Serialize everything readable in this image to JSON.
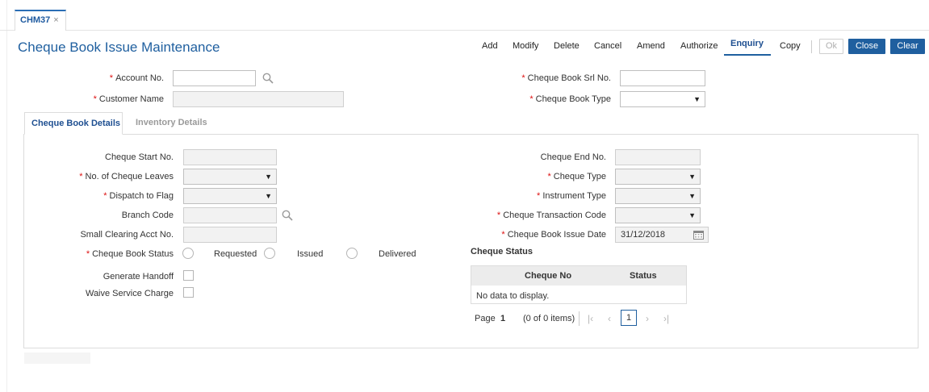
{
  "tab": {
    "label": "CHM37",
    "close": "×"
  },
  "title": "Cheque Book Issue Maintenance",
  "toolbar": {
    "links": [
      "Add",
      "Modify",
      "Delete",
      "Cancel",
      "Amend",
      "Authorize",
      "Enquiry",
      "Copy"
    ],
    "active": "Enquiry",
    "ok": "Ok",
    "close": "Close",
    "clear": "Clear"
  },
  "header_form": {
    "account_no": {
      "label": "Account No.",
      "value": ""
    },
    "customer_name": {
      "label": "Customer Name",
      "value": ""
    },
    "cheque_book_srl_no": {
      "label": "Cheque Book Srl No.",
      "value": ""
    },
    "cheque_book_type": {
      "label": "Cheque Book Type",
      "value": ""
    }
  },
  "subtabs": {
    "details": "Cheque Book Details",
    "inventory": "Inventory Details"
  },
  "details": {
    "cheque_start_no": {
      "label": "Cheque Start No.",
      "value": ""
    },
    "no_of_cheque_leaves": {
      "label": "No. of Cheque Leaves",
      "value": ""
    },
    "dispatch_to_flag": {
      "label": "Dispatch to Flag",
      "value": ""
    },
    "branch_code": {
      "label": "Branch Code",
      "value": ""
    },
    "small_clearing_acct_no": {
      "label": "Small Clearing Acct No.",
      "value": ""
    },
    "cheque_book_status": {
      "label": "Cheque Book Status",
      "options": [
        "Requested",
        "Issued",
        "Delivered"
      ]
    },
    "generate_handoff": {
      "label": "Generate Handoff"
    },
    "waive_service_charge": {
      "label": "Waive Service Charge"
    },
    "cheque_end_no": {
      "label": "Cheque End No.",
      "value": ""
    },
    "cheque_type": {
      "label": "Cheque Type",
      "value": ""
    },
    "instrument_type": {
      "label": "Instrument Type",
      "value": ""
    },
    "cheque_transaction_code": {
      "label": "Cheque Transaction Code",
      "value": ""
    },
    "cheque_book_issue_date": {
      "label": "Cheque Book Issue Date",
      "value": "31/12/2018"
    }
  },
  "cheque_status": {
    "title": "Cheque Status",
    "columns": [
      "Cheque No",
      "Status"
    ],
    "empty": "No data to display.",
    "pager": {
      "page_label": "Page",
      "page": "1",
      "items": "(0 of 0 items)",
      "current": "1"
    }
  },
  "colors": {
    "accent": "#1f5f9f",
    "required": "#dd1111"
  },
  "icons": [
    "search-icon",
    "calendar-icon",
    "dropdown-arrow-icon",
    "first-page-icon",
    "prev-page-icon",
    "next-page-icon",
    "last-page-icon"
  ]
}
